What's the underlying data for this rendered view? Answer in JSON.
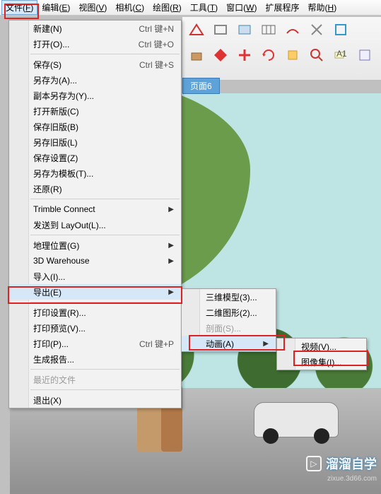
{
  "menubar": {
    "file": {
      "label": "文件",
      "key": "F"
    },
    "edit": {
      "label": "编辑",
      "key": "E"
    },
    "view": {
      "label": "视图",
      "key": "V"
    },
    "camera": {
      "label": "相机",
      "key": "C"
    },
    "draw": {
      "label": "绘图",
      "key": "R"
    },
    "tools": {
      "label": "工具",
      "key": "T"
    },
    "window": {
      "label": "窗口",
      "key": "W"
    },
    "extensions": {
      "label": "扩展程序"
    },
    "help": {
      "label": "帮助",
      "key": "H"
    }
  },
  "file_menu": {
    "new": {
      "label": "新建(N)",
      "shortcut": "Ctrl 键+N"
    },
    "open": {
      "label": "打开(O)...",
      "shortcut": "Ctrl 键+O"
    },
    "save": {
      "label": "保存(S)",
      "shortcut": "Ctrl 键+S"
    },
    "saveas": {
      "label": "另存为(A)..."
    },
    "savecopy": {
      "label": "副本另存为(Y)..."
    },
    "opennew": {
      "label": "打开新版(C)"
    },
    "saveold": {
      "label": "保存旧版(B)"
    },
    "saveasold": {
      "label": "另存旧版(L)"
    },
    "savesettings": {
      "label": "保存设置(Z)"
    },
    "saveastemplate": {
      "label": "另存为模板(T)..."
    },
    "revert": {
      "label": "还原(R)"
    },
    "trimble": {
      "label": "Trimble Connect"
    },
    "sendlayout": {
      "label": "发送到 LayOut(L)..."
    },
    "geolocation": {
      "label": "地理位置(G)"
    },
    "warehouse": {
      "label": "3D Warehouse"
    },
    "import": {
      "label": "导入(I)..."
    },
    "export": {
      "label": "导出(E)"
    },
    "printsetup": {
      "label": "打印设置(R)..."
    },
    "printpreview": {
      "label": "打印预览(V)..."
    },
    "print": {
      "label": "打印(P)...",
      "shortcut": "Ctrl 键+P"
    },
    "report": {
      "label": "生成报告..."
    },
    "recent": {
      "label": "最近的文件"
    },
    "exit": {
      "label": "退出(X)"
    }
  },
  "export_menu": {
    "model3d": {
      "label": "三维模型(3)..."
    },
    "graphic2d": {
      "label": "二维图形(2)..."
    },
    "section": {
      "label": "剖面(S)..."
    },
    "animation": {
      "label": "动画(A)"
    }
  },
  "anim_menu": {
    "video": {
      "label": "视频(V)..."
    },
    "imageset": {
      "label": "图像集(I)..."
    }
  },
  "tab": {
    "label": "页面6"
  },
  "watermark": {
    "brand": "溜溜自学",
    "site": "zixue.3d66.com"
  }
}
